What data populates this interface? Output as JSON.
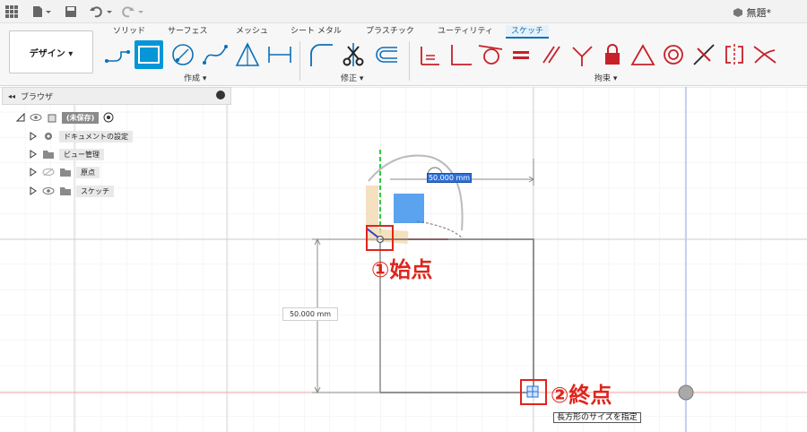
{
  "app": {
    "doc_title": "無題*"
  },
  "tabs": [
    {
      "label": "ソリッド"
    },
    {
      "label": "サーフェス"
    },
    {
      "label": "メッシュ"
    },
    {
      "label": "シート メタル"
    },
    {
      "label": "プラスチック"
    },
    {
      "label": "ユーティリティ"
    },
    {
      "label": "スケッチ"
    }
  ],
  "workspace_button": "デザイン ▾",
  "groups": {
    "create": "作成 ▾",
    "modify": "修正 ▾",
    "constraints": "拘束 ▾"
  },
  "browser": {
    "title": "ブラウザ",
    "items": [
      {
        "label": "(未保存)"
      },
      {
        "label": "ドキュメントの設定"
      },
      {
        "label": "ビュー管理"
      },
      {
        "label": "原点"
      },
      {
        "label": "スケッチ"
      }
    ]
  },
  "dimensions": {
    "horizontal": "50.000 mm",
    "vertical": "50.000 mm"
  },
  "annotations": {
    "start": "①始点",
    "end": "②終点"
  },
  "tooltip": "長方形のサイズを指定",
  "colors": {
    "accent": "#0696d7",
    "annotation": "#e0241b",
    "x_axis": "#e8383d",
    "y_axis": "#2ecc40"
  }
}
